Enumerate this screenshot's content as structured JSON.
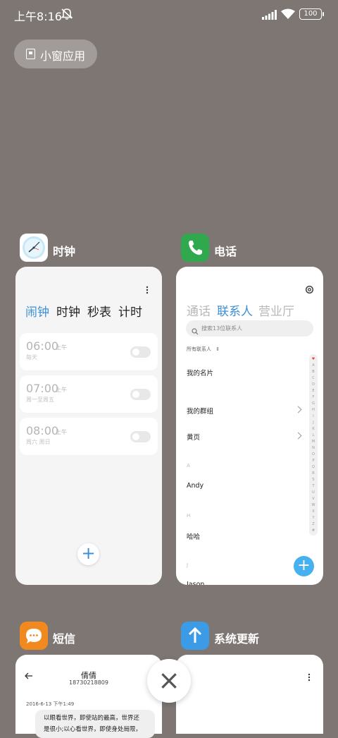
{
  "status_bar": {
    "time": "上午8:16",
    "battery": "100"
  },
  "small_window_button": {
    "label": "小窗应用"
  },
  "apps": {
    "clock": {
      "title": "时钟",
      "tabs": [
        "闹钟",
        "时钟",
        "秒表",
        "计时"
      ],
      "alarms": [
        {
          "time": "06:00",
          "ampm": "上午",
          "repeat": "每天"
        },
        {
          "time": "07:00",
          "ampm": "上午",
          "repeat": "周一至周五"
        },
        {
          "time": "08:00",
          "ampm": "上午",
          "repeat": "周六 周日"
        }
      ],
      "add_label": "+"
    },
    "phone": {
      "title": "电话",
      "tabs": [
        "通话",
        "联系人",
        "营业厅"
      ],
      "search_placeholder": "搜索13位联系人",
      "all_contacts": "所有联系人",
      "rows": {
        "my_card": "我的名片",
        "my_groups": "我的群组",
        "yellow_pages": "黄页"
      },
      "sections": {
        "a": "A",
        "h": "H",
        "j": "J"
      },
      "contacts": {
        "andy": "Andy",
        "haha": "哈哈",
        "jason": "Jason"
      },
      "alphabet": [
        "♥",
        "A",
        "B",
        "C",
        "D",
        "E",
        "F",
        "G",
        "H",
        "I",
        "J",
        "K",
        "L",
        "M",
        "N",
        "O",
        "P",
        "Q",
        "R",
        "S",
        "T",
        "U",
        "V",
        "W",
        "X",
        "Y",
        "Z",
        "#"
      ],
      "add_label": "+"
    },
    "sms": {
      "title": "短信",
      "contact_name": "倩倩",
      "contact_number": "18730218809",
      "timestamp": "2016-6-13 下午1:49",
      "message_line1": "以眼看世界，即使站的最高，世界还",
      "message_line2": "是很小;以心看世界，即使身处局限，"
    },
    "update": {
      "title": "系统更新"
    }
  },
  "close_button": {
    "label": "×"
  },
  "colors": {
    "accent": "#3a8fd8",
    "background": "#7d7673",
    "phone_green": "#2fa84e",
    "sms_orange": "#f08a1f",
    "update_blue": "#3c9be6"
  }
}
